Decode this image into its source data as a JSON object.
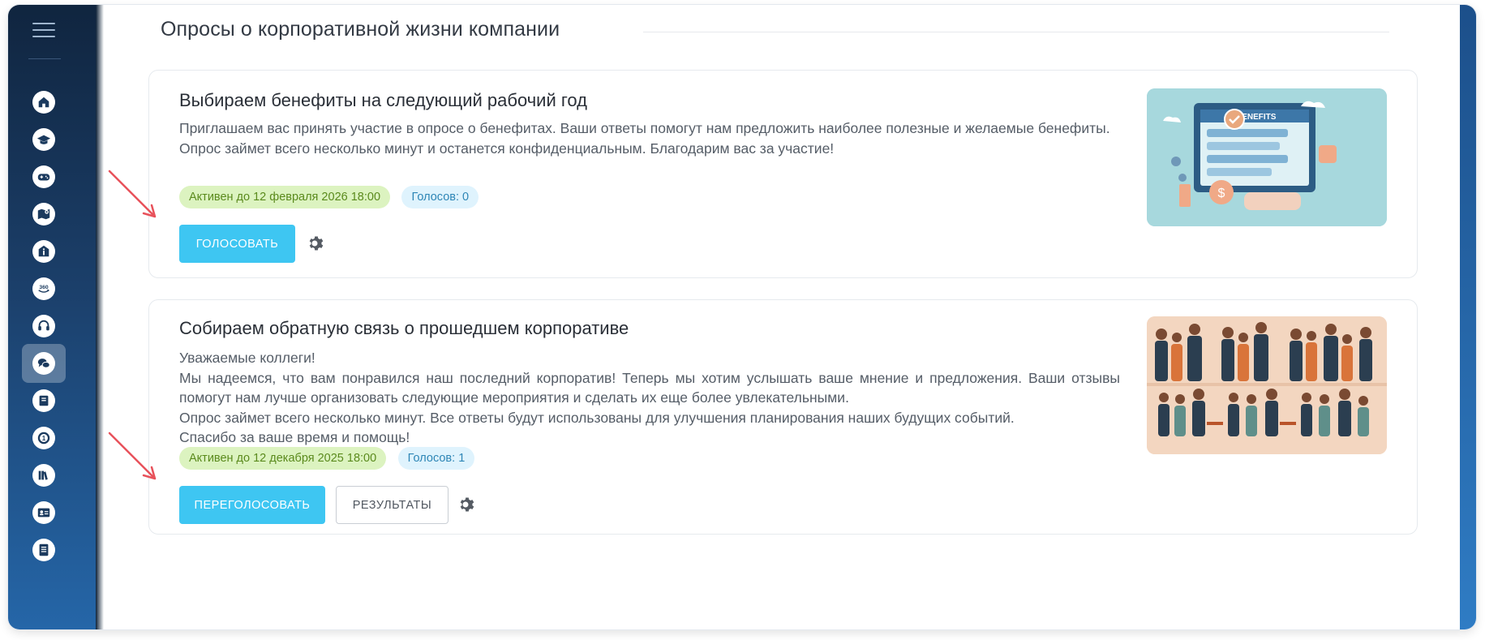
{
  "sidebar": {
    "items": [
      {
        "name": "nav-home",
        "icon": "home-icon"
      },
      {
        "name": "nav-education",
        "icon": "graduation-cap-icon"
      },
      {
        "name": "nav-games",
        "icon": "gamepad-icon"
      },
      {
        "name": "nav-map",
        "icon": "map-icon"
      },
      {
        "name": "nav-info",
        "icon": "info-icon"
      },
      {
        "name": "nav-360",
        "icon": "360-icon",
        "text": "360"
      },
      {
        "name": "nav-support",
        "icon": "headset-icon"
      },
      {
        "name": "nav-polls",
        "icon": "chat-bubbles-icon",
        "active": true
      },
      {
        "name": "nav-notebook",
        "icon": "notebook-icon"
      },
      {
        "name": "nav-badge",
        "icon": "number-one-badge-icon"
      },
      {
        "name": "nav-library",
        "icon": "library-icon"
      },
      {
        "name": "nav-id-card",
        "icon": "id-card-icon"
      },
      {
        "name": "nav-document",
        "icon": "document-icon"
      }
    ]
  },
  "page": {
    "title": "Опросы о корпоративной жизни компании"
  },
  "polls": [
    {
      "title": "Выбираем бенефиты на следующий рабочий год",
      "description": [
        "Приглашаем вас принять участие в опросе о бенефитах. Ваши ответы помогут нам предложить наиболее полезные и желаемые бенефиты.",
        "Опрос займет всего несколько минут и останется конфиденциальным. Благодарим вас за участие!"
      ],
      "active_badge": "Активен до 12 февраля 2026 18:00",
      "votes_badge": "Голосов: 0",
      "primary_button": "Голосовать",
      "image_label": "BENEFITS"
    },
    {
      "title": "Собираем обратную связь о прошедшем корпоративе",
      "description": [
        "Уважаемые коллеги!",
        "Мы надеемся, что вам понравился наш последний корпоратив! Теперь мы хотим услышать ваше мнение и предложения. Ваши отзывы помогут нам лучше организовать следующие мероприятия и сделать их еще более увлекательными.",
        "Опрос займет всего несколько минут. Все ответы будут использованы для улучшения планирования наших будущих событий.",
        "Спасибо за ваше время и помощь!"
      ],
      "active_badge": "Активен до 12 декабря 2025 18:00",
      "votes_badge": "Голосов: 1",
      "primary_button": "Переголосовать",
      "secondary_button": "Результаты"
    }
  ],
  "colors": {
    "accent": "#3ec6f2",
    "active_badge_bg": "#dcf3c0",
    "votes_badge_bg": "#dff3fd",
    "annotation_arrow": "#e8525b"
  }
}
